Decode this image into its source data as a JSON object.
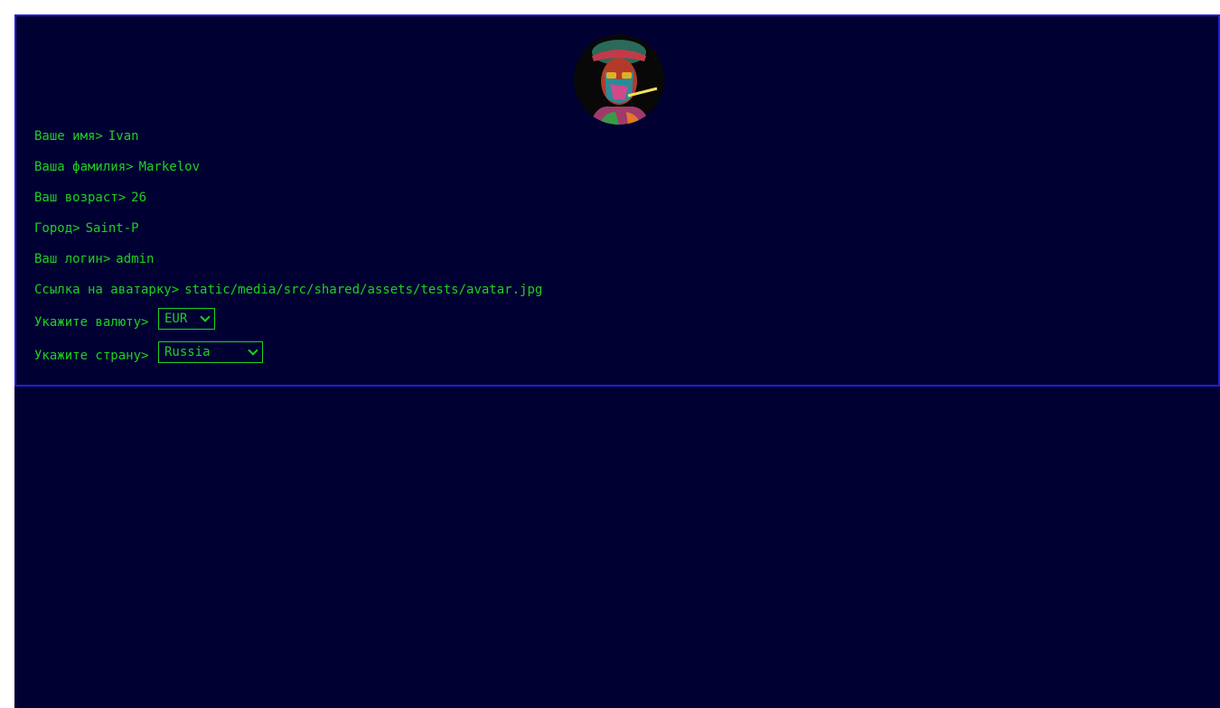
{
  "profile": {
    "avatar_icon": "user-avatar-portrait",
    "fields": [
      {
        "label": "Ваше имя>",
        "value": "Ivan"
      },
      {
        "label": "Ваша фамилия>",
        "value": "Markelov"
      },
      {
        "label": "Ваш возраст>",
        "value": "26"
      },
      {
        "label": "Город>",
        "value": "Saint-P"
      },
      {
        "label": "Ваш логин>",
        "value": "admin"
      },
      {
        "label": "Ссылка на аватарку>",
        "value": "static/media/src/shared/assets/tests/avatar.jpg"
      }
    ],
    "currency": {
      "label": "Укажите валюту>",
      "selected": "EUR"
    },
    "country": {
      "label": "Укажите страну>",
      "selected": "Russia"
    }
  },
  "colors": {
    "background": "#000033",
    "border": "#1f1fd6",
    "text": "#1fd11f"
  }
}
